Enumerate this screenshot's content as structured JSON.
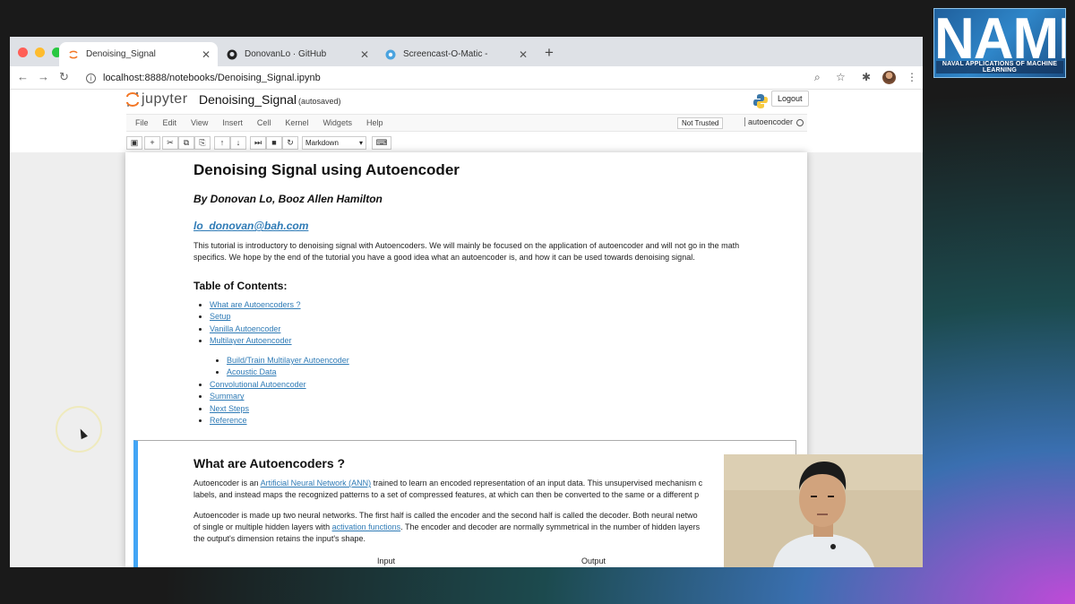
{
  "logo": {
    "big_text": "NAML",
    "small_text": "NAVAL APPLICATIONS OF MACHINE LEARNING"
  },
  "browser": {
    "tabs": [
      {
        "title": "Denoising_Signal",
        "icon": "jupyter-favicon-icon",
        "active": true
      },
      {
        "title": "DonovanLo · GitHub",
        "icon": "github-icon",
        "active": false
      },
      {
        "title": "Screencast-O-Matic -",
        "icon": "screencast-icon",
        "active": false
      }
    ],
    "url": "localhost:8888/notebooks/Denoising_Signal.ipynb",
    "colors": {
      "close": "#ff5f57",
      "minimize": "#febc2e",
      "maximize": "#28c840"
    }
  },
  "jupyter": {
    "logo_text": "jupyter",
    "notebook_name": "Denoising_Signal",
    "autosave": "(autosaved)",
    "logout_label": "Logout",
    "menu": [
      "File",
      "Edit",
      "View",
      "Insert",
      "Cell",
      "Kernel",
      "Widgets",
      "Help"
    ],
    "trust_label": "Not Trusted",
    "kernel_name": "autoencoder",
    "cell_type": "Markdown"
  },
  "notebook": {
    "title": "Denoising Signal using Autoencoder",
    "author": "By Donovan Lo, Booz Allen Hamilton",
    "email": "lo_donovan@bah.com",
    "intro_line1": "This tutorial is introductory to denoising signal with Autoencoders. We will mainly be focused on the application of autoencoder and will not go in the math",
    "intro_line2": "specifics. We hope by the end of the tutorial you have a good idea what an autoencoder is, and how it can be used towards denoising signal.",
    "toc_heading": "Table of Contents:",
    "toc": [
      "What are Autoencoders ?",
      "Setup",
      "Vanilla Autoencoder",
      "Multilayer Autoencoder"
    ],
    "toc_sub": [
      "Build/Train Multilayer Autoencoder",
      "Acoustic Data"
    ],
    "toc_rest": [
      "Convolutional Autoencoder",
      "Summary",
      "Next Steps",
      "Reference"
    ],
    "section_title": "What are Autoencoders ?",
    "p1a": "Autoencoder is an ",
    "p1_link": "Artificial Neural Network (ANN)",
    "p1b": " trained to learn an encoded representation of an input data. This unsupervised mechanism c",
    "p1_line2": "labels, and instead maps the recognized patterns to a set of compressed features, at which can then be converted to the same or a different p",
    "p2_line1": "Autoencoder is made up two neural networks. The first half is called the encoder and the second half is called the decoder. Both neural netwo",
    "p2a": "of single or multiple hidden layers with ",
    "p2_link": "activation functions",
    "p2b": ". The encoder and decoder are normally symmetrical in the number of hidden layers",
    "p2_line3": "the output's dimension retains the input's shape.",
    "input_label": "Input",
    "output_label": "Output"
  }
}
